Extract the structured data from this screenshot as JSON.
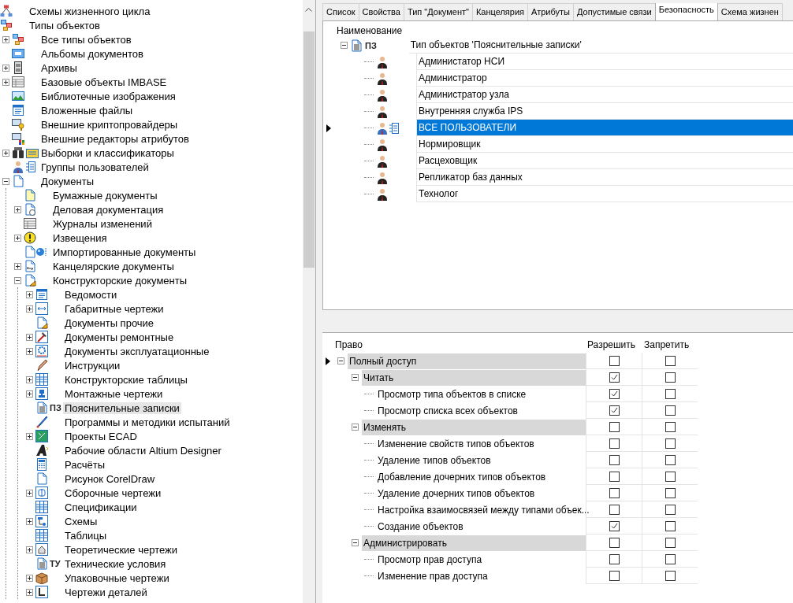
{
  "object_tree": {
    "items": [
      {
        "label": "Схемы жизненного цикла",
        "selected": false
      },
      {
        "label": "Типы объектов",
        "selected": false,
        "children": [
          {
            "label": "Все типы объектов",
            "expanded": false,
            "selected": false
          },
          {
            "label": "Альбомы документов",
            "selected": false
          },
          {
            "label": "Архивы",
            "expanded": false,
            "selected": false
          },
          {
            "label": "Базовые объекты IMBASE",
            "expanded": false,
            "selected": false
          },
          {
            "label": "Библиотечные изображения",
            "selected": false
          },
          {
            "label": "Вложенные файлы",
            "selected": false
          },
          {
            "label": "Внешние криптопровайдеры",
            "selected": false
          },
          {
            "label": "Внешние редакторы атрибутов",
            "selected": false
          },
          {
            "label": "Выборки и классификаторы",
            "expanded": false,
            "selected": false
          },
          {
            "label": "Группы пользователей",
            "selected": false
          },
          {
            "label": "Документы",
            "expanded": true,
            "selected": false,
            "children": [
              {
                "label": "Бумажные документы",
                "selected": false
              },
              {
                "label": "Деловая документация",
                "expanded": false,
                "selected": false
              },
              {
                "label": "Журналы изменений",
                "selected": false
              },
              {
                "label": "Извещения",
                "expanded": false,
                "selected": false
              },
              {
                "label": "Импортированные документы",
                "selected": false
              },
              {
                "label": "Канцелярские документы",
                "expanded": false,
                "selected": false
              },
              {
                "label": "Конструкторские документы",
                "expanded": true,
                "selected": false,
                "children": [
                  {
                    "label": "Ведомости",
                    "expanded": false,
                    "selected": false
                  },
                  {
                    "label": "Габаритные чертежи",
                    "expanded": false,
                    "selected": false
                  },
                  {
                    "label": "Документы прочие",
                    "selected": false
                  },
                  {
                    "label": "Документы ремонтные",
                    "expanded": false,
                    "selected": false
                  },
                  {
                    "label": "Документы эксплуатационные",
                    "expanded": false,
                    "selected": false
                  },
                  {
                    "label": "Инструкции",
                    "selected": false
                  },
                  {
                    "label": "Конструкторские таблицы",
                    "expanded": false,
                    "selected": false
                  },
                  {
                    "label": "Монтажные чертежи",
                    "expanded": false,
                    "selected": false
                  },
                  {
                    "label": "Пояснительные записки",
                    "prefix": "ПЗ",
                    "selected": true
                  },
                  {
                    "label": "Программы и методики испытаний",
                    "selected": false
                  },
                  {
                    "label": "Проекты ECAD",
                    "expanded": false,
                    "selected": false
                  },
                  {
                    "label": "Рабочие области Altium Designer",
                    "selected": false
                  },
                  {
                    "label": "Расчёты",
                    "selected": false
                  },
                  {
                    "label": "Рисунок CorelDraw",
                    "selected": false
                  },
                  {
                    "label": "Сборочные чертежи",
                    "expanded": false,
                    "selected": false
                  },
                  {
                    "label": "Спецификации",
                    "selected": false
                  },
                  {
                    "label": "Схемы",
                    "expanded": false,
                    "selected": false
                  },
                  {
                    "label": "Таблицы",
                    "selected": false
                  },
                  {
                    "label": "Теоретические чертежи",
                    "expanded": false,
                    "selected": false
                  },
                  {
                    "label": "Технические условия",
                    "prefix": "ТУ",
                    "selected": false
                  },
                  {
                    "label": "Упаковочные чертежи",
                    "expanded": false,
                    "selected": false
                  },
                  {
                    "label": "Чертежи деталей",
                    "expanded": false,
                    "selected": false
                  }
                ]
              }
            ]
          }
        ]
      }
    ]
  },
  "tabs": [
    {
      "label": "Список",
      "selected": false
    },
    {
      "label": "Свойства",
      "selected": false
    },
    {
      "label": "Тип \"Документ\"",
      "selected": false
    },
    {
      "label": "Канцелярия",
      "selected": false
    },
    {
      "label": "Атрибуты",
      "selected": false
    },
    {
      "label": "Допустимые связи",
      "selected": false
    },
    {
      "label": "Безопасность",
      "selected": true
    },
    {
      "label": "Схема жизнен",
      "selected": false
    }
  ],
  "subjects": {
    "column": "Наименование",
    "root": {
      "prefix": "ПЗ",
      "label": "Тип объектов 'Пояснительные записки'",
      "expanded": true
    },
    "rows": [
      {
        "label": "Администатор НСИ",
        "kind": "user",
        "selected": false
      },
      {
        "label": "Администратор",
        "kind": "user",
        "selected": false
      },
      {
        "label": "Администратор узла",
        "kind": "user",
        "selected": false
      },
      {
        "label": "Внутренняя служба IPS",
        "kind": "user",
        "selected": false
      },
      {
        "label": "ВСЕ ПОЛЬЗОВАТЕЛИ",
        "kind": "group",
        "selected": true
      },
      {
        "label": "Нормировщик",
        "kind": "user",
        "selected": false
      },
      {
        "label": "Расцеховщик",
        "kind": "user",
        "selected": false
      },
      {
        "label": "Репликатор баз данных",
        "kind": "user",
        "selected": false
      },
      {
        "label": "Технолог",
        "kind": "user",
        "selected": false
      }
    ]
  },
  "rights": {
    "columns": [
      "Право",
      "Разрешить",
      "Запретить"
    ],
    "rows": [
      {
        "label": "Полный доступ",
        "expanded": true,
        "current": true,
        "allow": false,
        "deny": false,
        "children": [
          {
            "label": "Читать",
            "expanded": true,
            "current": false,
            "allow": true,
            "deny": false,
            "children": [
              {
                "label": "Просмотр типа объектов в списке",
                "current": false,
                "allow": true,
                "deny": false
              },
              {
                "label": "Просмотр списка всех объектов",
                "current": false,
                "allow": true,
                "deny": false
              }
            ]
          },
          {
            "label": "Изменять",
            "expanded": true,
            "current": false,
            "allow": false,
            "deny": false,
            "children": [
              {
                "label": "Изменение свойств типов объектов",
                "current": false,
                "allow": false,
                "deny": false
              },
              {
                "label": "Удаление типов объектов",
                "current": false,
                "allow": false,
                "deny": false
              },
              {
                "label": "Добавление дочерних типов объектов",
                "current": false,
                "allow": false,
                "deny": false
              },
              {
                "label": "Удаление дочерних типов объектов",
                "current": false,
                "allow": false,
                "deny": false
              },
              {
                "label": "Настройка взаимосвязей между типами объек...",
                "current": false,
                "allow": false,
                "deny": false
              },
              {
                "label": "Создание объектов",
                "current": false,
                "allow": true,
                "deny": false
              }
            ]
          },
          {
            "label": "Администрировать",
            "expanded": true,
            "current": false,
            "allow": false,
            "deny": false,
            "children": [
              {
                "label": "Просмотр прав доступа",
                "current": false,
                "allow": false,
                "deny": false
              },
              {
                "label": "Изменение прав доступа",
                "current": false,
                "allow": false,
                "deny": false
              }
            ]
          }
        ]
      }
    ]
  }
}
